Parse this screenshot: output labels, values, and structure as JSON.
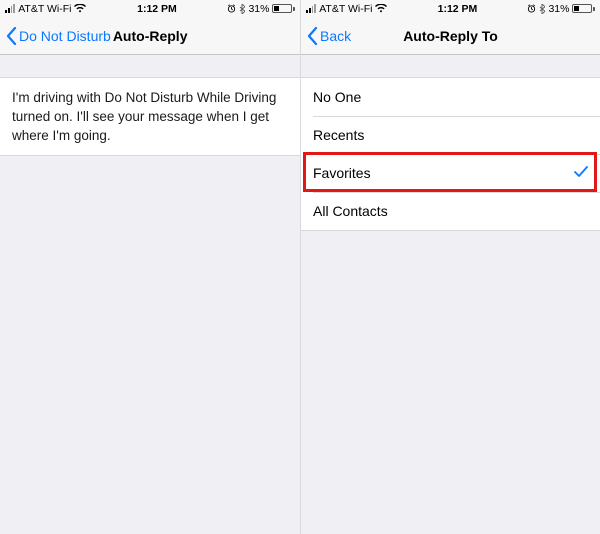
{
  "status": {
    "carrier": "AT&T Wi-Fi",
    "time": "1:12 PM",
    "battery_pct": "31%"
  },
  "left": {
    "back_label": "Do Not Disturb",
    "title": "Auto-Reply",
    "message": "I'm driving with Do Not Disturb While Driving turned on. I'll see your message when I get where I'm going."
  },
  "right": {
    "back_label": "Back",
    "title": "Auto-Reply To",
    "options": {
      "o0": "No One",
      "o1": "Recents",
      "o2": "Favorites",
      "o3": "All Contacts"
    },
    "selected_index": 2
  }
}
